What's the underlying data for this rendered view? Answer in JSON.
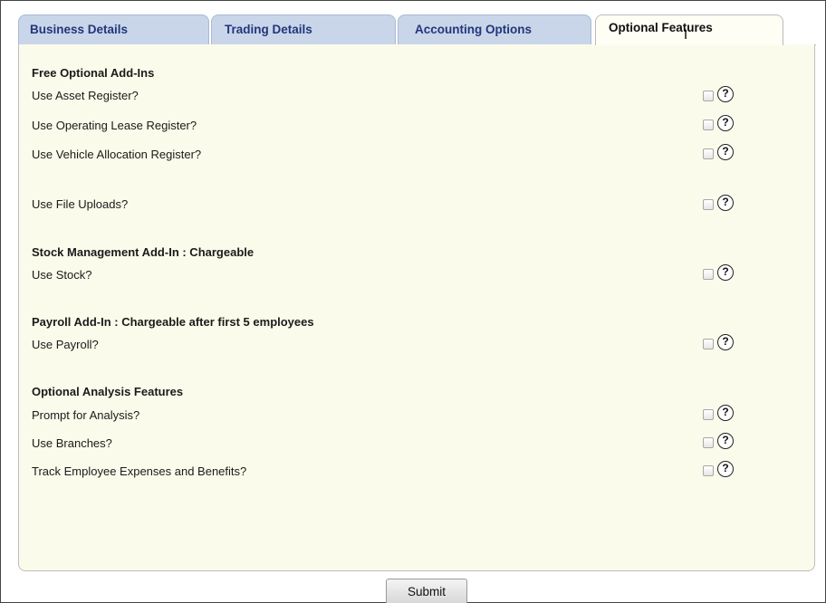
{
  "tabs": [
    {
      "label": "Business Details"
    },
    {
      "label": "Trading Details"
    },
    {
      "label": "Accounting Options"
    },
    {
      "label": "Optional Features"
    }
  ],
  "sections": {
    "free": {
      "heading": "Free Optional Add-Ins"
    },
    "stock": {
      "heading": "Stock Management Add-In : Chargeable"
    },
    "payroll": {
      "heading": "Payroll Add-In : Chargeable after first 5 employees"
    },
    "analysis": {
      "heading": "Optional Analysis Features"
    }
  },
  "options": [
    {
      "label": "Use Asset Register?",
      "checked": false
    },
    {
      "label": "Use Operating Lease Register?",
      "checked": false
    },
    {
      "label": "Use Vehicle Allocation Register?",
      "checked": false
    },
    {
      "label": "Use File Uploads?",
      "checked": false
    },
    {
      "label": "Use Stock?",
      "checked": false
    },
    {
      "label": "Use Payroll?",
      "checked": false
    },
    {
      "label": "Prompt for Analysis?",
      "checked": false
    },
    {
      "label": "Use Branches?",
      "checked": false
    },
    {
      "label": "Track Employee Expenses and Benefits?",
      "checked": false
    }
  ],
  "help_icon": {
    "glyph": "?"
  },
  "submit_label": "Submit"
}
